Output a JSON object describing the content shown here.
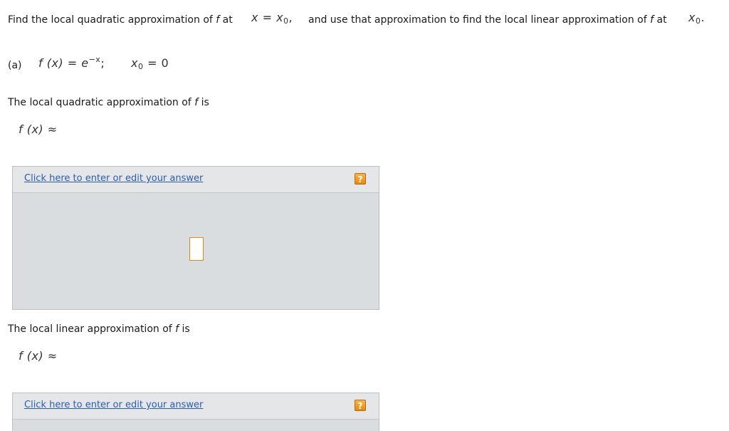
{
  "problem": {
    "intro_1": "Find the local quadratic approximation of",
    "f": "f",
    "at": "at",
    "x": "x",
    "equals": "=",
    "x0_base": "x",
    "x0_sub": "0",
    "comma": ",",
    "intro_2": "and use that approximation to find the local linear approximation of",
    "period": "."
  },
  "part_a": {
    "label": "(a)",
    "fx": "f (x) = e",
    "exponent": "−x",
    "semicolon": ";",
    "x0_base": "x",
    "x0_sub": "0",
    "x0_value": "= 0"
  },
  "quadratic": {
    "prompt_1": "The local quadratic approximation of",
    "f": "f",
    "prompt_2": "is",
    "lhs": "f (x) ≈",
    "link": "Click here to enter or edit your answer",
    "help": "?"
  },
  "linear": {
    "prompt_1": "The local linear approximation of",
    "f": "f",
    "prompt_2": "is",
    "lhs": "f (x) ≈",
    "link": "Click here to enter or edit your answer",
    "help": "?"
  }
}
